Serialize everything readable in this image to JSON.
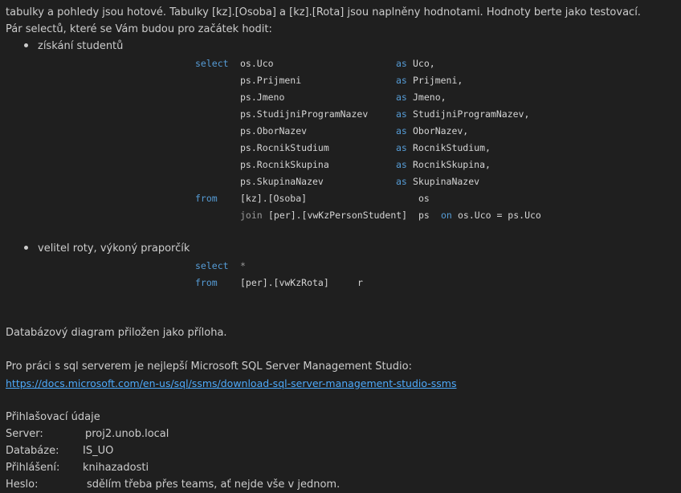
{
  "intro": {
    "line1": "tabulky a pohledy jsou hotové. Tabulky [kz].[Osoba] a [kz].[Rota] jsou naplněny hodnotami. Hodnoty berte jako testovací.",
    "line2": "Pár selectů, které se Vám budou pro začátek hodit:"
  },
  "bullets": [
    {
      "label": "získání studentů"
    },
    {
      "label": "velitel roty, výkoný praporčík"
    }
  ],
  "query1": {
    "select_kw": "select",
    "as_kw": "as",
    "columns": [
      {
        "expr": "os.Uco",
        "alias": "Uco,"
      },
      {
        "expr": "ps.Prijmeni",
        "alias": "Prijmeni,"
      },
      {
        "expr": "ps.Jmeno",
        "alias": "Jmeno,"
      },
      {
        "expr": "ps.StudijniProgramNazev",
        "alias": "StudijniProgramNazev,"
      },
      {
        "expr": "ps.OborNazev",
        "alias": "OborNazev,"
      },
      {
        "expr": "ps.RocnikStudium",
        "alias": "RocnikStudium,"
      },
      {
        "expr": "ps.RocnikSkupina",
        "alias": "RocnikSkupina,"
      },
      {
        "expr": "ps.SkupinaNazev",
        "alias": "SkupinaNazev"
      }
    ],
    "from_kw": "from",
    "from_table": "[kz].[Osoba]",
    "from_alias": "os",
    "join_kw": "join",
    "join_table": "[per].[vwKzPersonStudent]",
    "join_alias": "ps",
    "on_kw": "on",
    "on_condition": "os.Uco = ps.Uco"
  },
  "query2": {
    "select_kw": "select",
    "star": "*",
    "from_kw": "from",
    "from_table": "[per].[vwKzRota]",
    "from_alias": "r"
  },
  "diagram_note": "Databázový diagram přiložen jako příloha.",
  "ssms_note": "Pro práci s sql serverem je nejlepší Microsoft SQL Server Management Studio:",
  "ssms_link": "https://docs.microsoft.com/en-us/sql/ssms/download-sql-server-management-studio-ssms",
  "credentials": {
    "heading": "Přihlašovací údaje",
    "rows": [
      {
        "label": "Server:",
        "value": "proj2.unob.local"
      },
      {
        "label": "Databáze:",
        "value": "IS_UO"
      },
      {
        "label": "Přihlášení:",
        "value": "knihazadosti"
      },
      {
        "label": "Heslo:",
        "value": "sdělím třeba přes teams, ať nejde vše v jednom."
      }
    ]
  }
}
